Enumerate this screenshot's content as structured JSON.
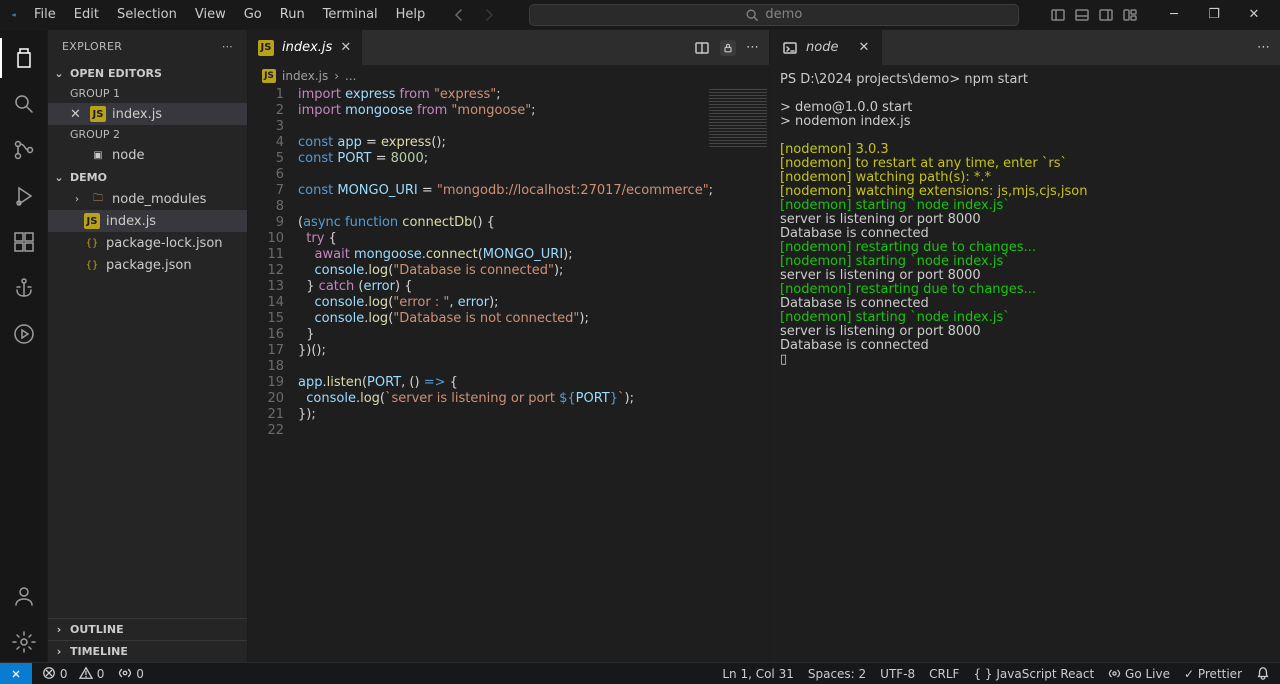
{
  "title_search_placeholder": "demo",
  "menu": [
    "File",
    "Edit",
    "Selection",
    "View",
    "Go",
    "Run",
    "Terminal",
    "Help"
  ],
  "explorer": {
    "title": "EXPLORER",
    "open_editors": "OPEN EDITORS",
    "group1": "GROUP 1",
    "group2": "GROUP 2",
    "editor1": "index.js",
    "editor2": "node",
    "project": "DEMO",
    "items": {
      "node_modules": "node_modules",
      "indexjs": "index.js",
      "pkglock": "package-lock.json",
      "pkg": "package.json"
    },
    "outline": "OUTLINE",
    "timeline": "TIMELINE"
  },
  "tab": {
    "label": "index.js",
    "breadcrumb_file": "index.js",
    "breadcrumb_sep": "›",
    "breadcrumb_dots": "..."
  },
  "code": {
    "lines": [
      {
        "n": 1,
        "html": "<span class='kw'>import</span> <span class='va'>express</span> <span class='kw'>from</span> <span class='st'>\"express\"</span>;"
      },
      {
        "n": 2,
        "html": "<span class='kw'>import</span> <span class='va'>mongoose</span> <span class='kw'>from</span> <span class='st'>\"mongoose\"</span>;"
      },
      {
        "n": 3,
        "html": ""
      },
      {
        "n": 4,
        "html": "<span class='cn'>const</span> <span class='va'>app</span> = <span class='fn'>express</span>();"
      },
      {
        "n": 5,
        "html": "<span class='cn'>const</span> <span class='va'>PORT</span> = <span class='nu'>8000</span>;"
      },
      {
        "n": 6,
        "html": ""
      },
      {
        "n": 7,
        "html": "<span class='cn'>const</span> <span class='va'>MONGO_URI</span> = <span class='st'>\"mongodb://localhost:27017/ecommerce\"</span>;"
      },
      {
        "n": 8,
        "html": ""
      },
      {
        "n": 9,
        "html": "(<span class='cn'>async</span> <span class='cn'>function</span> <span class='fn'>connectDb</span>() {"
      },
      {
        "n": 10,
        "html": "  <span class='kw'>try</span> {"
      },
      {
        "n": 11,
        "html": "    <span class='kw'>await</span> <span class='va'>mongoose</span>.<span class='fn'>connect</span>(<span class='va'>MONGO_URI</span>);"
      },
      {
        "n": 12,
        "html": "    <span class='va'>console</span>.<span class='fn'>log</span>(<span class='st'>\"Database is connected\"</span>);"
      },
      {
        "n": 13,
        "html": "  } <span class='kw'>catch</span> (<span class='va'>error</span>) {"
      },
      {
        "n": 14,
        "html": "    <span class='va'>console</span>.<span class='fn'>log</span>(<span class='st'>\"error : \"</span>, <span class='va'>error</span>);"
      },
      {
        "n": 15,
        "html": "    <span class='va'>console</span>.<span class='fn'>log</span>(<span class='st'>\"Database is not connected\"</span>);"
      },
      {
        "n": 16,
        "html": "  }"
      },
      {
        "n": 17,
        "html": "})();"
      },
      {
        "n": 18,
        "html": ""
      },
      {
        "n": 19,
        "html": "<span class='va'>app</span>.<span class='fn'>listen</span>(<span class='va'>PORT</span>, () <span class='cn'>=&gt;</span> {"
      },
      {
        "n": 20,
        "html": "  <span class='va'>console</span>.<span class='fn'>log</span>(<span class='st'>`server is listening or port </span><span class='cn'>${</span><span class='va'>PORT</span><span class='cn'>}</span><span class='st'>`</span>);"
      },
      {
        "n": 21,
        "html": "});"
      },
      {
        "n": 22,
        "html": ""
      }
    ]
  },
  "terminal": {
    "tab_label": "node",
    "lines": [
      {
        "cls": "",
        "text": "PS D:\\2024 projects\\demo> npm start"
      },
      {
        "cls": "",
        "text": ""
      },
      {
        "cls": "",
        "text": "> demo@1.0.0 start"
      },
      {
        "cls": "",
        "text": "> nodemon index.js"
      },
      {
        "cls": "",
        "text": ""
      },
      {
        "cls": "ty-y",
        "text": "[nodemon] 3.0.3"
      },
      {
        "cls": "ty-y",
        "text": "[nodemon] to restart at any time, enter `rs`"
      },
      {
        "cls": "ty-y",
        "text": "[nodemon] watching path(s): *.*"
      },
      {
        "cls": "ty-y",
        "text": "[nodemon] watching extensions: js,mjs,cjs,json"
      },
      {
        "cls": "ty-g",
        "text": "[nodemon] starting `node index.js`"
      },
      {
        "cls": "",
        "text": "server is listening or port 8000"
      },
      {
        "cls": "",
        "text": "Database is connected"
      },
      {
        "cls": "ty-g",
        "text": "[nodemon] restarting due to changes..."
      },
      {
        "cls": "ty-g",
        "text": "[nodemon] starting `node index.js`"
      },
      {
        "cls": "",
        "text": "server is listening or port 8000"
      },
      {
        "cls": "ty-g",
        "text": "[nodemon] restarting due to changes..."
      },
      {
        "cls": "",
        "text": "Database is connected"
      },
      {
        "cls": "ty-g",
        "text": "[nodemon] starting `node index.js`"
      },
      {
        "cls": "",
        "text": "server is listening or port 8000"
      },
      {
        "cls": "",
        "text": "Database is connected"
      },
      {
        "cls": "",
        "text": "▯"
      }
    ]
  },
  "status": {
    "errors": "0",
    "warnings": "0",
    "ports": "0",
    "ln_col": "Ln 1, Col 31",
    "spaces": "Spaces: 2",
    "encoding": "UTF-8",
    "eol": "CRLF",
    "lang": "JavaScript React",
    "golive": "Go Live",
    "prettier": "Prettier"
  }
}
